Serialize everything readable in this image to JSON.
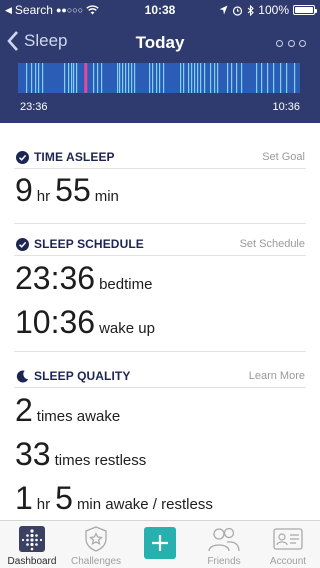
{
  "status_bar": {
    "carrier": "Search",
    "signal": "●●○○○",
    "time": "10:38",
    "battery": "100%"
  },
  "nav": {
    "back_label": "Sleep",
    "title": "Today"
  },
  "sleep_graph": {
    "start_time": "23:36",
    "end_time": "10:36",
    "awake_segments": [
      0.235,
      0.238
    ]
  },
  "sections": {
    "time_asleep": {
      "title": "TIME ASLEEP",
      "action": "Set Goal",
      "hours": "9",
      "hours_unit": "hr",
      "minutes": "55",
      "minutes_unit": "min"
    },
    "sleep_schedule": {
      "title": "SLEEP SCHEDULE",
      "action": "Set Schedule",
      "bedtime": "23:36",
      "bedtime_label": "bedtime",
      "wakeup": "10:36",
      "wakeup_label": "wake up"
    },
    "sleep_quality": {
      "title": "SLEEP QUALITY",
      "action": "Learn More",
      "awake_count": "2",
      "awake_label": "times awake",
      "restless_count": "33",
      "restless_label": "times restless",
      "duration_hours": "1",
      "duration_hours_unit": "hr",
      "duration_minutes": "5",
      "duration_label": "min awake / restless"
    }
  },
  "tabs": [
    {
      "label": "Dashboard",
      "icon": "dashboard-icon",
      "active": true
    },
    {
      "label": "Challenges",
      "icon": "star-badge-icon",
      "active": false
    },
    {
      "label": "",
      "icon": "plus-icon",
      "active": false
    },
    {
      "label": "Friends",
      "icon": "friends-icon",
      "active": false
    },
    {
      "label": "Account",
      "icon": "account-card-icon",
      "active": false
    }
  ],
  "colors": {
    "header_bg": "#2f3b6e",
    "graph_bg": "#2b5db6",
    "graph_line": "#7fd0f5",
    "awake_mark": "#e0489a",
    "accent": "#27b0ae"
  }
}
